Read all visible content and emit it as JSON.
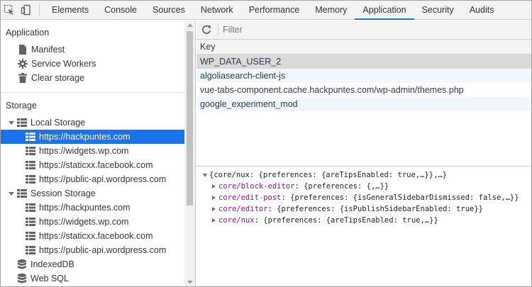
{
  "toolbar": {
    "tabs": [
      {
        "label": "Elements"
      },
      {
        "label": "Console"
      },
      {
        "label": "Sources"
      },
      {
        "label": "Network"
      },
      {
        "label": "Performance"
      },
      {
        "label": "Memory"
      },
      {
        "label": "Application",
        "active": true
      },
      {
        "label": "Security"
      },
      {
        "label": "Audits"
      }
    ],
    "icons": [
      "inspect-element-icon",
      "device-toolbar-icon"
    ]
  },
  "sidebar": {
    "application_title": "Application",
    "application_items": [
      {
        "label": "Manifest",
        "icon": "document-icon"
      },
      {
        "label": "Service Workers",
        "icon": "gear-icon"
      },
      {
        "label": "Clear storage",
        "icon": "trash-icon"
      }
    ],
    "storage_title": "Storage",
    "local_storage": {
      "label": "Local Storage",
      "items": [
        {
          "label": "https://hackpuntes.com",
          "selected": true
        },
        {
          "label": "https://widgets.wp.com"
        },
        {
          "label": "https://staticxx.facebook.com"
        },
        {
          "label": "https://public-api.wordpress.com"
        }
      ]
    },
    "session_storage": {
      "label": "Session Storage",
      "items": [
        {
          "label": "https://hackpuntes.com"
        },
        {
          "label": "https://widgets.wp.com"
        },
        {
          "label": "https://staticxx.facebook.com"
        },
        {
          "label": "https://public-api.wordpress.com"
        }
      ]
    },
    "indexeddb": {
      "label": "IndexedDB"
    },
    "websql": {
      "label": "Web SQL"
    }
  },
  "main": {
    "filter": {
      "placeholder": "Filter",
      "value": ""
    },
    "table": {
      "column_header": "Key",
      "rows": [
        {
          "key": "WP_DATA_USER_2",
          "selected": true
        },
        {
          "key": "algoliasearch-client-js"
        },
        {
          "key": "vue-tabs-component.cache.hackpuntes.com/wp-admin/themes.php"
        },
        {
          "key": "google_experiment_mod"
        }
      ]
    },
    "preview": {
      "root": "{core/nux: {preferences: {areTipsEnabled: true,…}},…}",
      "children": [
        {
          "key": "core/block-editor",
          "value": "{preferences: {,…}}"
        },
        {
          "key": "core/edit-post",
          "value": "{preferences: {isGeneralSidebarDismissed: false,…}}"
        },
        {
          "key": "core/editor",
          "value": "{preferences: {isPublishSidebarEnabled: true}}"
        },
        {
          "key": "core/nux",
          "value": "{preferences: {areTipsEnabled: true,…}}"
        }
      ]
    }
  },
  "colors": {
    "accent": "#1a73e8",
    "selected_row": "#dadada",
    "key_purple": "#881391"
  }
}
